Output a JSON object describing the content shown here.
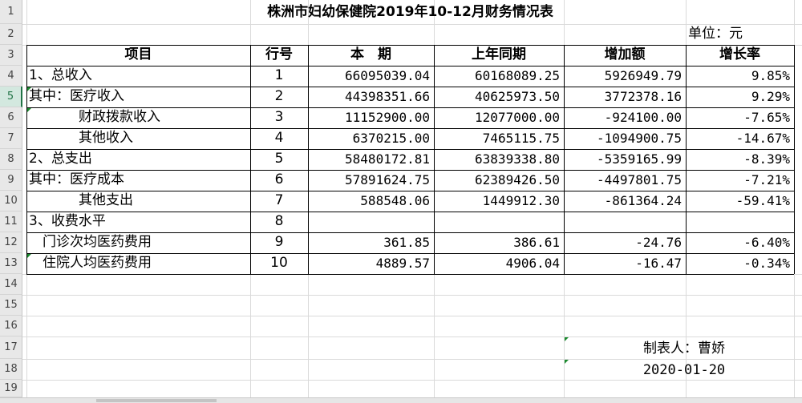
{
  "sheet": {
    "row_numbers": [
      "1",
      "2",
      "3",
      "4",
      "5",
      "6",
      "7",
      "8",
      "9",
      "10",
      "11",
      "12",
      "13",
      "14",
      "15",
      "16",
      "17",
      "18",
      "19"
    ],
    "selected_row": "5",
    "title": "株洲市妇幼保健院2019年10-12月财务情况表",
    "unit": "单位：元",
    "headers": {
      "item": "项目",
      "line_no": "行号",
      "current": "本　期",
      "prior": "上年同期",
      "increase": "增加额",
      "growth": "增长率"
    },
    "rows": [
      {
        "item": "1、总收入",
        "line": "1",
        "current": "66095039.04",
        "prior": "60168089.25",
        "increase": "5926949.79",
        "growth": "9.85%"
      },
      {
        "item": "其中：医疗收入",
        "line": "2",
        "current": "44398351.66",
        "prior": "40625973.50",
        "increase": "3772378.16",
        "growth": "9.29%"
      },
      {
        "item": "财政拨款收入",
        "line": "3",
        "current": "11152900.00",
        "prior": "12077000.00",
        "increase": "-924100.00",
        "growth": "-7.65%"
      },
      {
        "item": "其他收入",
        "line": "4",
        "current": "6370215.00",
        "prior": "7465115.75",
        "increase": "-1094900.75",
        "growth": "-14.67%"
      },
      {
        "item": "2、总支出",
        "line": "5",
        "current": "58480172.81",
        "prior": "63839338.80",
        "increase": "-5359165.99",
        "growth": "-8.39%"
      },
      {
        "item": "其中：医疗成本",
        "line": "6",
        "current": "57891624.75",
        "prior": "62389426.50",
        "increase": "-4497801.75",
        "growth": "-7.21%"
      },
      {
        "item": "其他支出",
        "line": "7",
        "current": "588548.06",
        "prior": "1449912.30",
        "increase": "-861364.24",
        "growth": "-59.41%"
      },
      {
        "item": "3、收费水平",
        "line": "8",
        "current": "",
        "prior": "",
        "increase": "",
        "growth": ""
      },
      {
        "item": "门诊次均医药费用",
        "line": "9",
        "current": "361.85",
        "prior": "386.61",
        "increase": "-24.76",
        "growth": "-6.40%"
      },
      {
        "item": "住院人均医药费用",
        "line": "10",
        "current": "4889.57",
        "prior": "4906.04",
        "increase": "-16.47",
        "growth": "-0.34%"
      }
    ],
    "preparer": "制表人：曹娇",
    "date": "2020-01-20"
  }
}
